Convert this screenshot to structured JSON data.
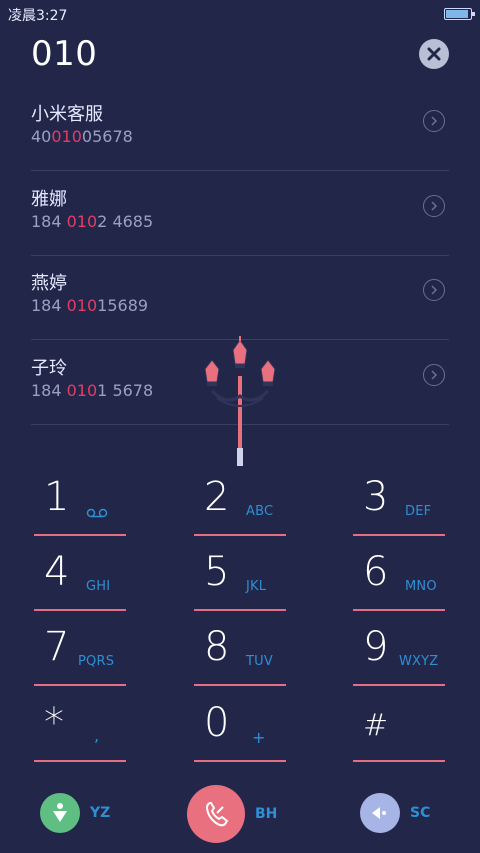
{
  "status": {
    "time": "凌晨3:27"
  },
  "search": {
    "query": "010"
  },
  "contacts": [
    {
      "name": "小米客服",
      "number_pre": "40",
      "number_hl": "010",
      "number_post": "05678"
    },
    {
      "name": "雅娜",
      "number_pre": "184 ",
      "number_hl": "010",
      "number_post": "2 4685"
    },
    {
      "name": "燕婷",
      "number_pre": "184 ",
      "number_hl": "010",
      "number_post": "15689"
    },
    {
      "name": "子玲",
      "number_pre": "184 ",
      "number_hl": "010",
      "number_post": "1 5678"
    }
  ],
  "keypad": [
    {
      "digit": "1",
      "letters": "",
      "icon": "voicemail-icon"
    },
    {
      "digit": "2",
      "letters": "ABC"
    },
    {
      "digit": "3",
      "letters": "DEF"
    },
    {
      "digit": "4",
      "letters": "GHI"
    },
    {
      "digit": "5",
      "letters": "JKL"
    },
    {
      "digit": "6",
      "letters": "MNO"
    },
    {
      "digit": "7",
      "letters": "PQRS"
    },
    {
      "digit": "8",
      "letters": "TUV"
    },
    {
      "digit": "9",
      "letters": "WXYZ"
    },
    {
      "digit": "*",
      "letters": ","
    },
    {
      "digit": "0",
      "letters": "+"
    },
    {
      "digit": "#",
      "letters": ""
    }
  ],
  "actions": {
    "left_label": "YZ",
    "center_label": "BH",
    "right_label": "SC"
  },
  "colors": {
    "background": "#222649",
    "highlight": "#e23d66",
    "accent_blue": "#2e8fd4",
    "key_underline": "#e56d87",
    "call_button": "#e8707f",
    "left_button": "#5fbf83",
    "right_button": "#a7b4e6"
  }
}
